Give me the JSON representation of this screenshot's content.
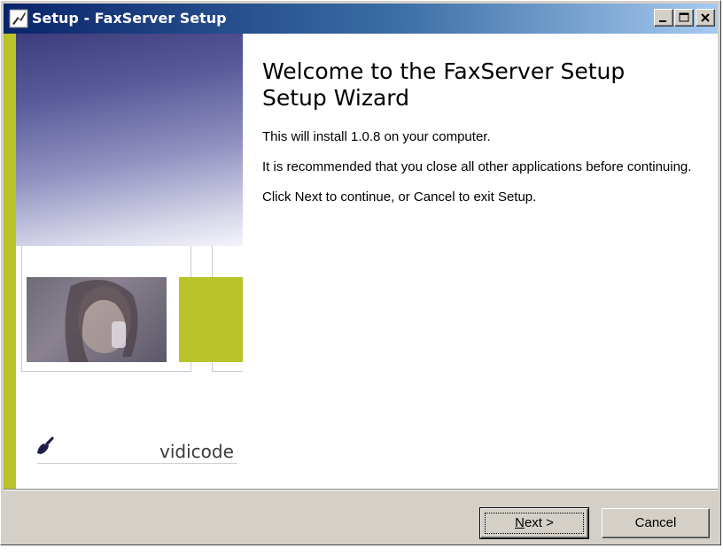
{
  "window": {
    "title": "Setup - FaxServer Setup"
  },
  "icons": {
    "app": "installer-app-icon",
    "minimize": "minimize-icon",
    "maximize": "maximize-icon",
    "close": "close-icon",
    "brand": "vidicode-logo-icon"
  },
  "side_panel": {
    "brand": "vidicode"
  },
  "main": {
    "title": "Welcome to the FaxServer Setup\nSetup Wizard",
    "paragraphs": [
      "This will install 1.0.8 on your computer.",
      "It is recommended that you close all other applications before continuing.",
      "Click Next to continue, or Cancel to exit Setup."
    ]
  },
  "buttons": {
    "next_mnemonic": "N",
    "next_rest": "ext >",
    "cancel": "Cancel"
  },
  "colors": {
    "accent_green": "#b8c42a",
    "titlebar_start": "#0a246a",
    "titlebar_end": "#a6caf0",
    "dialog_face": "#d4d0c8"
  }
}
